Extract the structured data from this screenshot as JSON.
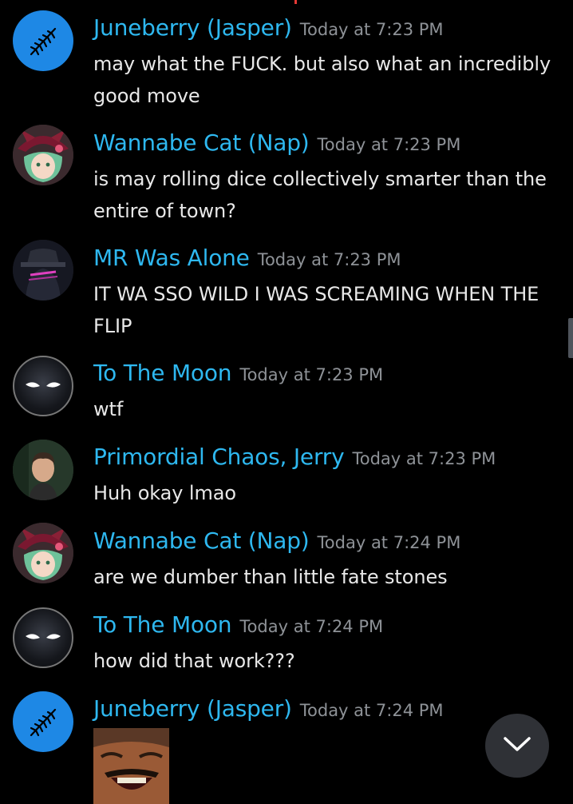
{
  "messages": [
    {
      "author": "Juneberry (Jasper)",
      "timestamp": "Today at 7:23 PM",
      "text": "may what the FUCK. but also what an incredibly good move",
      "avatar": "wheat-icon"
    },
    {
      "author": "Wannabe Cat (Nap)",
      "timestamp": "Today at 7:23 PM",
      "text": "is may rolling dice collectively smarter than the entire of town?",
      "avatar": "cat-girl-avatar"
    },
    {
      "author": "MR Was Alone",
      "timestamp": "Today at 7:23 PM",
      "text": "IT WA SSO WILD I WAS SCREAMING WHEN THE FLIP",
      "avatar": "hooded-figure-avatar"
    },
    {
      "author": "To The Moon",
      "timestamp": "Today at 7:23 PM",
      "text": "wtf",
      "avatar": "glowing-eyes-avatar"
    },
    {
      "author": "Primordial Chaos, Jerry",
      "timestamp": "Today at 7:23 PM",
      "text": "Huh okay lmao",
      "avatar": "person-photo-avatar"
    },
    {
      "author": "Wannabe Cat (Nap)",
      "timestamp": "Today at 7:24 PM",
      "text": "are we dumber than little fate stones",
      "avatar": "cat-girl-avatar"
    },
    {
      "author": "To The Moon",
      "timestamp": "Today at 7:24 PM",
      "text": "how did that work???",
      "avatar": "glowing-eyes-avatar"
    },
    {
      "author": "Juneberry (Jasper)",
      "timestamp": "Today at 7:24 PM",
      "text": "",
      "avatar": "wheat-icon",
      "attachment": "laughing-man-image"
    }
  ],
  "colors": {
    "author": "#2eb8f0",
    "timestamp": "#8e9297",
    "text": "#e8e8e8",
    "background": "#000000"
  },
  "jump_button": {
    "icon": "chevron-down-icon"
  }
}
